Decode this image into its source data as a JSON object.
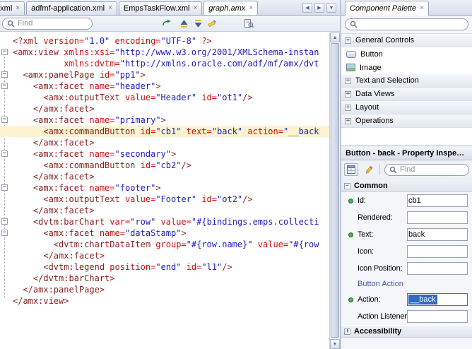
{
  "icons": {
    "close": "×",
    "collapse": "−",
    "expand": "+",
    "tab_prev": "◀",
    "tab_next": "▶",
    "tab_menu": "▼",
    "scroll_up": "▲",
    "scroll_down": "▼"
  },
  "editor_tabs": {
    "tabs": [
      {
        "label": "e.xml",
        "active": false
      },
      {
        "label": "adfmf-application.xml",
        "active": false
      },
      {
        "label": "EmpsTaskFlow.xml",
        "active": false
      },
      {
        "label": "graph.amx",
        "active": true
      }
    ]
  },
  "find_bar": {
    "placeholder": "Find"
  },
  "editor": {
    "lines": [
      {
        "t": [
          [
            "e",
            "<?xml"
          ],
          [
            "a",
            " version="
          ],
          [
            "v",
            "\"1.0\""
          ],
          [
            "a",
            " encoding="
          ],
          [
            "v",
            "\"UTF-8\""
          ],
          [
            "e",
            " ?>"
          ]
        ]
      },
      {
        "fold": true,
        "t": [
          [
            "e",
            "<amx:view"
          ],
          [
            "a",
            " xmlns:xsi="
          ],
          [
            "v",
            "\"http://www.w3.org/2001/XMLSchema-instan"
          ]
        ]
      },
      {
        "t": [
          [
            "p",
            "          "
          ],
          [
            "a",
            "xmlns:dvtm="
          ],
          [
            "v",
            "\"http://xmlns.oracle.com/adf/mf/amx/dvt"
          ]
        ]
      },
      {
        "fold": true,
        "t": [
          [
            "p",
            "  "
          ],
          [
            "e",
            "<amx:panelPage"
          ],
          [
            "a",
            " id="
          ],
          [
            "v",
            "\"pp1\""
          ],
          [
            "e",
            ">"
          ]
        ]
      },
      {
        "fold": true,
        "t": [
          [
            "p",
            "    "
          ],
          [
            "e",
            "<amx:facet"
          ],
          [
            "a",
            " name="
          ],
          [
            "v",
            "\"header\""
          ],
          [
            "e",
            ">"
          ]
        ]
      },
      {
        "t": [
          [
            "p",
            "      "
          ],
          [
            "e",
            "<amx:outputText"
          ],
          [
            "a",
            " value="
          ],
          [
            "v",
            "\"Header\""
          ],
          [
            "a",
            " id="
          ],
          [
            "v",
            "\"ot1\""
          ],
          [
            "e",
            "/>"
          ]
        ]
      },
      {
        "t": [
          [
            "p",
            "    "
          ],
          [
            "e",
            "</amx:facet>"
          ]
        ]
      },
      {
        "fold": true,
        "t": [
          [
            "p",
            "    "
          ],
          [
            "e",
            "<amx:facet"
          ],
          [
            "a",
            " name="
          ],
          [
            "v",
            "\"primary\""
          ],
          [
            "e",
            ">"
          ]
        ]
      },
      {
        "hl": true,
        "t": [
          [
            "p",
            "      "
          ],
          [
            "e",
            "<amx:commandButton"
          ],
          [
            "a",
            " id="
          ],
          [
            "v",
            "\"cb1\""
          ],
          [
            "a",
            " text="
          ],
          [
            "v",
            "\"back\""
          ],
          [
            "a",
            " action="
          ],
          [
            "v",
            "\"__back"
          ]
        ]
      },
      {
        "t": [
          [
            "p",
            "    "
          ],
          [
            "e",
            "</amx:facet>"
          ]
        ]
      },
      {
        "fold": true,
        "t": [
          [
            "p",
            "    "
          ],
          [
            "e",
            "<amx:facet"
          ],
          [
            "a",
            " name="
          ],
          [
            "v",
            "\"secondary\""
          ],
          [
            "e",
            ">"
          ]
        ]
      },
      {
        "t": [
          [
            "p",
            "      "
          ],
          [
            "e",
            "<amx:commandButton"
          ],
          [
            "a",
            " id="
          ],
          [
            "v",
            "\"cb2\""
          ],
          [
            "e",
            "/>"
          ]
        ]
      },
      {
        "t": [
          [
            "p",
            "    "
          ],
          [
            "e",
            "</amx:facet>"
          ]
        ]
      },
      {
        "fold": true,
        "t": [
          [
            "p",
            "    "
          ],
          [
            "e",
            "<amx:facet"
          ],
          [
            "a",
            " name="
          ],
          [
            "v",
            "\"footer\""
          ],
          [
            "e",
            ">"
          ]
        ]
      },
      {
        "t": [
          [
            "p",
            "      "
          ],
          [
            "e",
            "<amx:outputText"
          ],
          [
            "a",
            " value="
          ],
          [
            "v",
            "\"Footer\""
          ],
          [
            "a",
            " id="
          ],
          [
            "v",
            "\"ot2\""
          ],
          [
            "e",
            "/>"
          ]
        ]
      },
      {
        "t": [
          [
            "p",
            "    "
          ],
          [
            "e",
            "</amx:facet>"
          ]
        ]
      },
      {
        "fold": true,
        "t": [
          [
            "p",
            "    "
          ],
          [
            "e",
            "<dvtm:barChart"
          ],
          [
            "a",
            " var="
          ],
          [
            "v",
            "\"row\""
          ],
          [
            "a",
            " value="
          ],
          [
            "v",
            "\"#{bindings.emps.collecti"
          ]
        ]
      },
      {
        "fold": true,
        "t": [
          [
            "p",
            "      "
          ],
          [
            "e",
            "<amx:facet"
          ],
          [
            "a",
            " name="
          ],
          [
            "v",
            "\"dataStamp\""
          ],
          [
            "e",
            ">"
          ]
        ]
      },
      {
        "t": [
          [
            "p",
            "        "
          ],
          [
            "e",
            "<dvtm:chartDataItem"
          ],
          [
            "a",
            " group="
          ],
          [
            "v",
            "\"#{row.name}\""
          ],
          [
            "a",
            " value="
          ],
          [
            "v",
            "\"#{row"
          ]
        ]
      },
      {
        "t": [
          [
            "p",
            "      "
          ],
          [
            "e",
            "</amx:facet>"
          ]
        ]
      },
      {
        "t": [
          [
            "p",
            "      "
          ],
          [
            "e",
            "<dvtm:legend"
          ],
          [
            "a",
            " position="
          ],
          [
            "v",
            "\"end\""
          ],
          [
            "a",
            " id="
          ],
          [
            "v",
            "\"l1\""
          ],
          [
            "e",
            "/>"
          ]
        ]
      },
      {
        "t": [
          [
            "p",
            "    "
          ],
          [
            "e",
            "</dvtm:barChart>"
          ]
        ]
      },
      {
        "t": [
          [
            "p",
            "  "
          ],
          [
            "e",
            "</amx:panelPage>"
          ]
        ]
      },
      {
        "t": [
          [
            "e",
            "</amx:view>"
          ]
        ]
      }
    ]
  },
  "palette": {
    "tab_label": "Component Palette",
    "items": [
      {
        "type": "group",
        "label": "General Controls"
      },
      {
        "type": "item",
        "label": "Button",
        "icon": "button-icon"
      },
      {
        "type": "item",
        "label": "Image",
        "icon": "image-icon"
      },
      {
        "type": "group",
        "label": "Text and Selection"
      },
      {
        "type": "group",
        "label": "Data Views"
      },
      {
        "type": "group",
        "label": "Layout"
      },
      {
        "type": "group",
        "label": "Operations"
      }
    ]
  },
  "inspector": {
    "title": "Button - back - Property Inspector",
    "find_placeholder": "Find",
    "common_section": "Common",
    "fields": [
      {
        "label": "Id:",
        "value": "cb1",
        "dot": true
      },
      {
        "label": "Rendered:",
        "value": "",
        "dot": false
      },
      {
        "label": "Text:",
        "value": "back",
        "dot": true
      },
      {
        "label": "Icon:",
        "value": "",
        "dot": false
      },
      {
        "label": "Icon Position:",
        "value": "",
        "dot": false
      }
    ],
    "subsection": "Button Action",
    "action_fields": [
      {
        "label": "Action:",
        "value": "__back",
        "dot": true,
        "selected": true
      },
      {
        "label": "Action Listener:",
        "value": "",
        "dot": false
      }
    ],
    "accessibility_section": "Accessibility"
  }
}
